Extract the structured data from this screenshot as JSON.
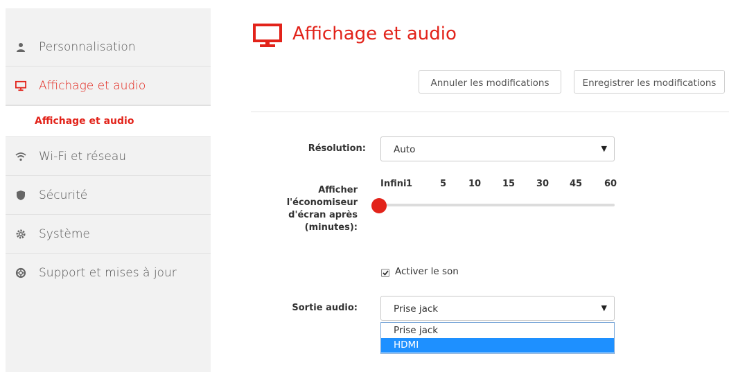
{
  "sidebar": {
    "items": [
      {
        "label": "Personnalisation",
        "icon": "person-icon"
      },
      {
        "label": "Affichage et audio",
        "icon": "monitor-icon",
        "active": true
      },
      {
        "label": "Wi-Fi et réseau",
        "icon": "wifi-icon"
      },
      {
        "label": "Sécurité",
        "icon": "shield-icon"
      },
      {
        "label": "Système",
        "icon": "gear-icon"
      },
      {
        "label": "Support et mises à jour",
        "icon": "lifebuoy-icon"
      }
    ],
    "subitem": {
      "label": "Affichage et audio"
    }
  },
  "header": {
    "title": "Affichage et audio",
    "icon": "monitor-icon",
    "cancel_label": "Annuler les modifications",
    "save_label": "Enregistrer les modifications"
  },
  "form": {
    "resolution": {
      "label": "Résolution:",
      "value": "Auto"
    },
    "screensaver": {
      "label_lines": [
        "Afficher",
        "l'économiseur",
        "d'écran après",
        "(minutes):"
      ],
      "ticks": [
        "Infini",
        "1",
        "5",
        "10",
        "15",
        "30",
        "45",
        "60"
      ],
      "selected": "Infini"
    },
    "sound": {
      "label": "Activer le son",
      "checked": true
    },
    "audio_output": {
      "label": "Sortie audio:",
      "value": "Prise jack",
      "options": [
        "Prise jack",
        "HDMI"
      ],
      "highlighted": "HDMI"
    }
  },
  "colors": {
    "accent": "#e2231a",
    "highlight": "#1e90ff",
    "sidebar_bg": "#f2f2f2"
  }
}
